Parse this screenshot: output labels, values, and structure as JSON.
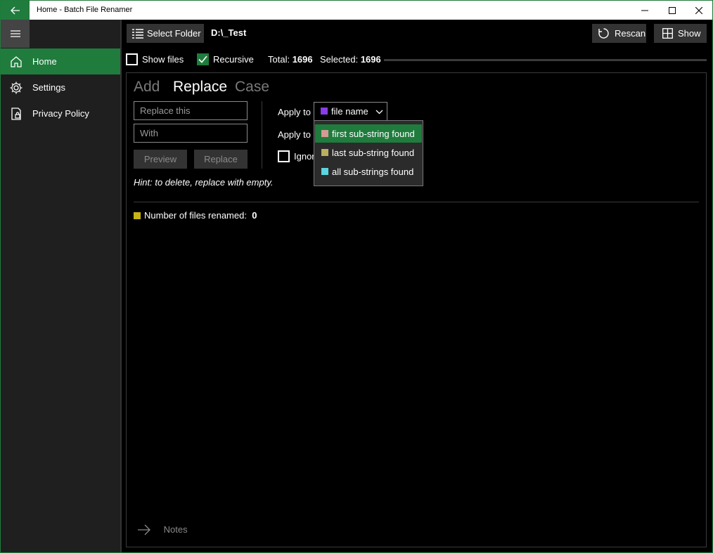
{
  "window": {
    "title": "Home - Batch File Renamer"
  },
  "sidebar": {
    "items": [
      {
        "label": "Home",
        "icon": "home-icon",
        "active": true
      },
      {
        "label": "Settings",
        "icon": "gear-icon",
        "active": false
      },
      {
        "label": "Privacy Policy",
        "icon": "privacy-icon",
        "active": false
      }
    ]
  },
  "toolbar": {
    "select_folder_label": "Select Folder",
    "path": "D:\\_Test",
    "rescan_label": "Rescan",
    "show_label": "Show"
  },
  "options": {
    "show_files_label": "Show files",
    "show_files_checked": false,
    "recursive_label": "Recursive",
    "recursive_checked": true,
    "total_label": "Total:",
    "total_value": "1696",
    "selected_label": "Selected:",
    "selected_value": "1696"
  },
  "tabs": [
    {
      "label": "Add",
      "active": false
    },
    {
      "label": "Replace",
      "active": true
    },
    {
      "label": "Case",
      "active": false
    }
  ],
  "replace": {
    "replace_placeholder": "Replace this",
    "with_placeholder": "With",
    "preview_label": "Preview",
    "replace_label": "Replace",
    "hint": "Hint: to delete, replace with empty.",
    "apply_to_label_1": "Apply to",
    "apply_to_label_2": "Apply to",
    "apply_to_value": "file name",
    "ignore_label": "Ignor",
    "dropdown_options": [
      {
        "label": "first sub-string found",
        "selected": true
      },
      {
        "label": "last sub-string found",
        "selected": false
      },
      {
        "label": "all sub-strings found",
        "selected": false
      }
    ]
  },
  "status": {
    "files_renamed_label": "Number of files renamed:",
    "files_renamed_value": "0"
  },
  "notes_label": "Notes",
  "colors": {
    "accent": "#1f7c3d",
    "file_name_swatch": "#8a3ce6",
    "first_swatch": "#d69a94",
    "last_swatch": "#b8b060",
    "all_swatch": "#5ad6e0",
    "counter_swatch": "#c8b414"
  }
}
